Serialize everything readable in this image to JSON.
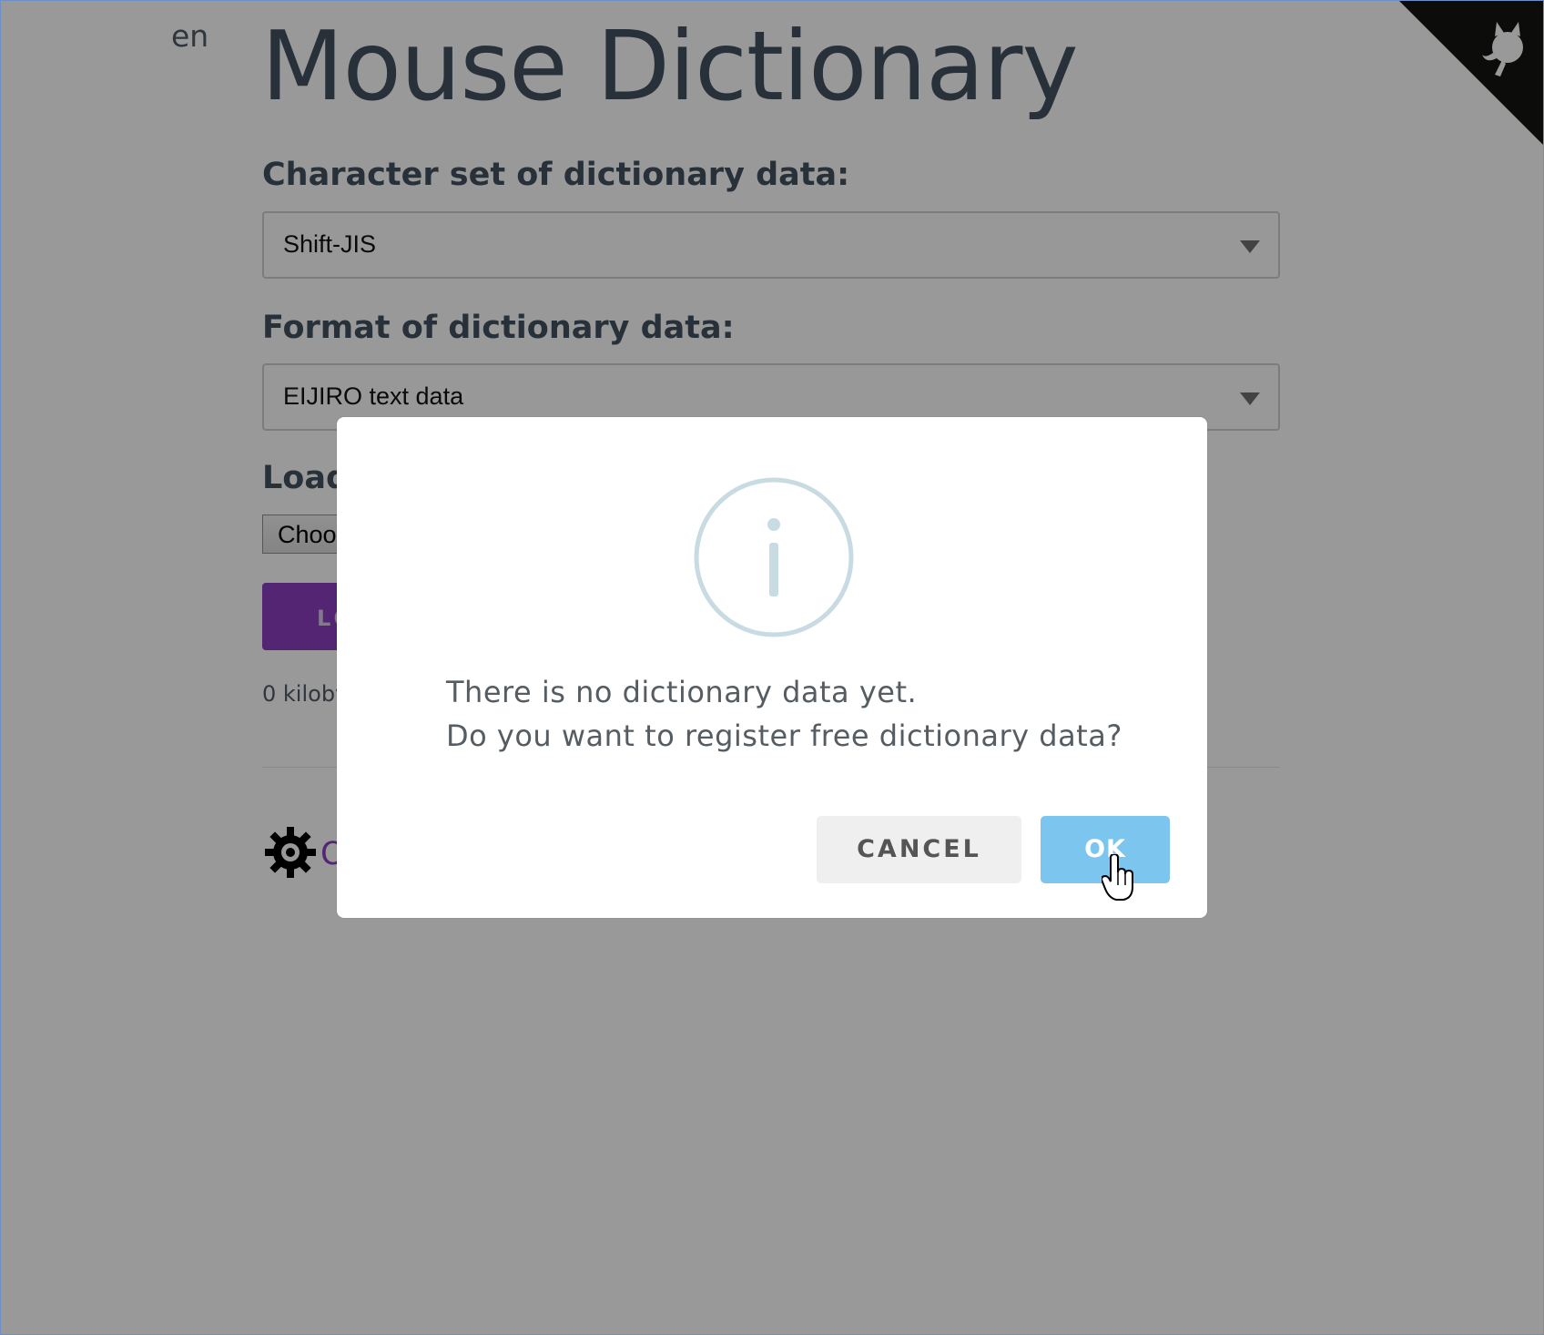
{
  "page": {
    "lang": "en",
    "title": "Mouse Dictionary",
    "charset_label": "Character set of dictionary data:",
    "charset_value": "Shift-JIS",
    "format_label": "Format of dictionary data:",
    "format_value": "EIJIRO text data",
    "load_label": "Load",
    "choose_file_label": "Choos",
    "load_button_label": "LO",
    "size_text": "0 kiloby",
    "options_link_label": "O"
  },
  "dialog": {
    "icon": "info-icon",
    "message_line1": "There is no dictionary data yet.",
    "message_line2": "Do you want to register free dictionary data?",
    "cancel_label": "CANCEL",
    "ok_label": "OK"
  },
  "colors": {
    "accent_purple": "#8a3fbf",
    "ok_button": "#7cc5ee",
    "cancel_button": "#efefef",
    "title_text": "#44535f",
    "overlay": "rgba(0,0,0,0.4)"
  }
}
